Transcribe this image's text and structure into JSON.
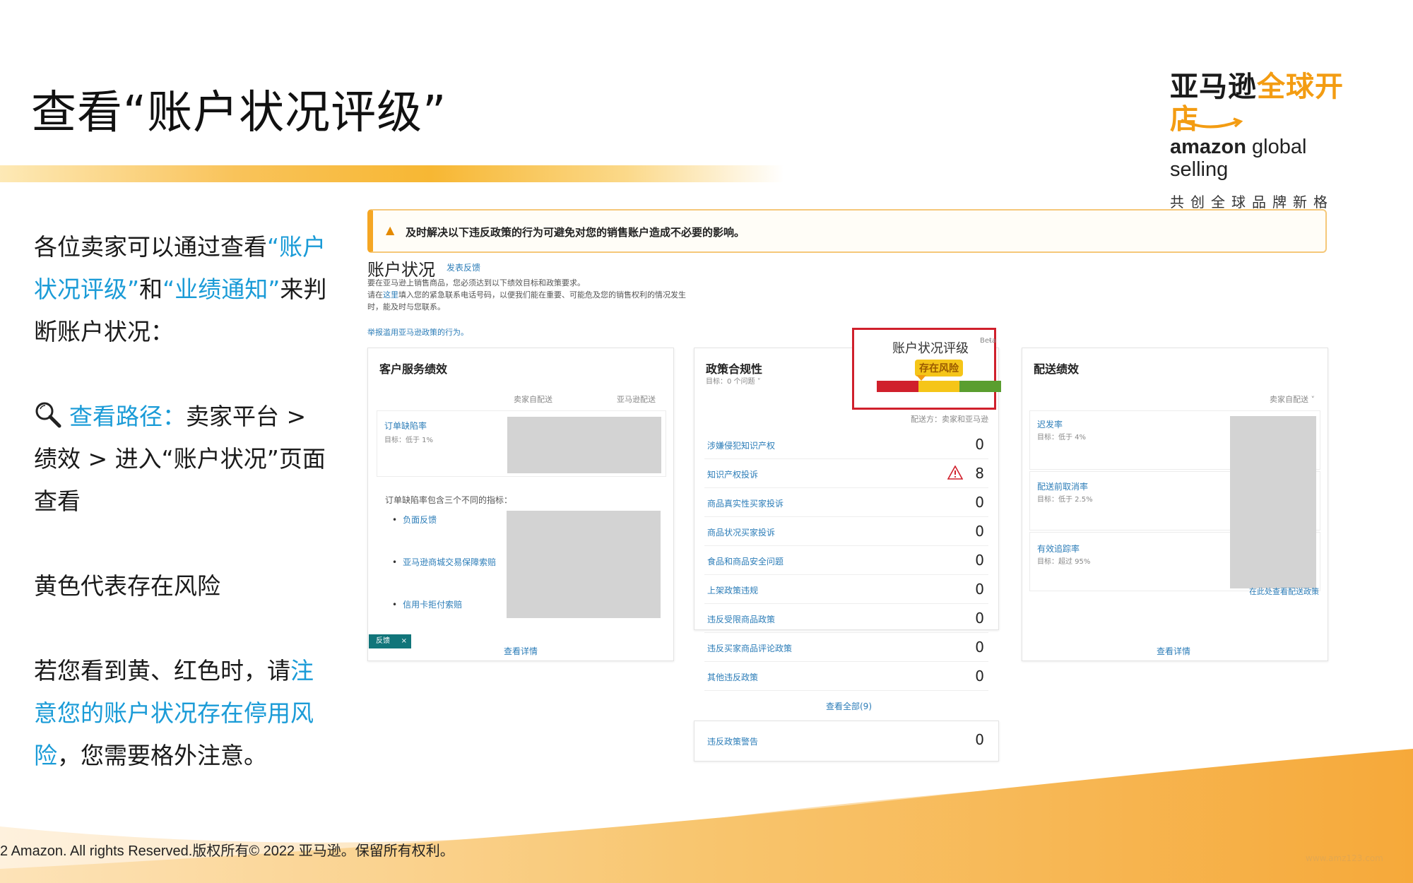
{
  "header": {
    "title": "查看“账户状况评级”",
    "brand": {
      "cn_dark": "亚马逊",
      "cn_orange": "全球开店",
      "en_bold": "amazon",
      "en_light": "global selling",
      "tagline": "共创全球品牌新格局",
      "accent": "#f39c12"
    }
  },
  "left": {
    "p1": {
      "a": "各位卖家可以通过查看",
      "b": "“账户状况评级”",
      "c": "和",
      "d": "“业绩通知”",
      "e": "来判断账户状况："
    },
    "p2": {
      "icon": "magnifier-icon",
      "a": "查看路径：",
      "b": "卖家平台 > 绩效 > 进入“账户状况”页面查看"
    },
    "p3": "黄色代表存在风险",
    "p4": {
      "a": "若您看到黄、红色时，请",
      "b": "注意您的账户状况存在停用风险",
      "c": "，您需要格外注意。"
    },
    "highlight": "#1a9bd7"
  },
  "screenshot": {
    "alert": "及时解决以下违反政策的行为可避免对您的销售账户造成不必要的影响。",
    "account": {
      "heading": "账户状况",
      "feedback": "发表反馈",
      "desc1": "要在亚马逊上销售商品，您必须达到以下绩效目标和政策要求。",
      "desc2a": "请在",
      "desc2link": "这里",
      "desc2b": "填入您的紧急联系电话号码，以便我们能在重要、可能危及您的销售权利的情况发生时，能及时与您联系。",
      "report": "举报滥用亚马逊政策的行为。"
    },
    "customer": {
      "title": "客户服务绩效",
      "col1": "卖家自配送",
      "col2": "亚马逊配送",
      "odr_label": "订单缺陷率",
      "odr_target": "目标：低于 1%",
      "breakdown": "订单缺陷率包含三个不同的指标：",
      "bullets": [
        "负面反馈",
        "亚马逊商城交易保障索赔",
        "信用卡拒付索赔"
      ],
      "tag": "反馈",
      "tag_close": "×",
      "view": "查看详情"
    },
    "policy": {
      "title": "政策合规性",
      "target": "目标：0 个问题",
      "chev": "˅",
      "delivery": "配送方：卖家和亚马逊",
      "rows": [
        {
          "label": "涉嫌侵犯知识产权",
          "value": "0"
        },
        {
          "label": "知识产权投诉",
          "value": "8",
          "warn": true
        },
        {
          "label": "商品真实性买家投诉",
          "value": "0"
        },
        {
          "label": "商品状况买家投诉",
          "value": "0"
        },
        {
          "label": "食品和商品安全问题",
          "value": "0"
        },
        {
          "label": "上架政策违规",
          "value": "0"
        },
        {
          "label": "违反受限商品政策",
          "value": "0"
        },
        {
          "label": "违反买家商品评论政策",
          "value": "0"
        },
        {
          "label": "其他违反政策",
          "value": "0"
        }
      ],
      "view_all": "查看全部(9)",
      "warning_label": "违反政策警告",
      "warning_value": "0"
    },
    "rating": {
      "title": "账户状况评级",
      "beta": "Beta",
      "chev": "˅",
      "status": "存在风险",
      "colors": [
        "#d0202c",
        "#f5c518",
        "#5a9e2f"
      ]
    },
    "shipping": {
      "title": "配送绩效",
      "col": "卖家自配送 ˅",
      "metrics": [
        {
          "label": "迟发率",
          "target": "目标：低于 4%"
        },
        {
          "label": "配送前取消率",
          "target": "目标：低于 2.5%"
        },
        {
          "label": "有效追踪率",
          "target": "目标：超过 95%"
        }
      ],
      "link": "在此处查看配送政策",
      "view": "查看详情"
    }
  },
  "footer": {
    "copyright": "2 Amazon. All rights Reserved.版权所有© 2022 亚马逊。保留所有权利。",
    "watermark": "www.amz123.com"
  }
}
